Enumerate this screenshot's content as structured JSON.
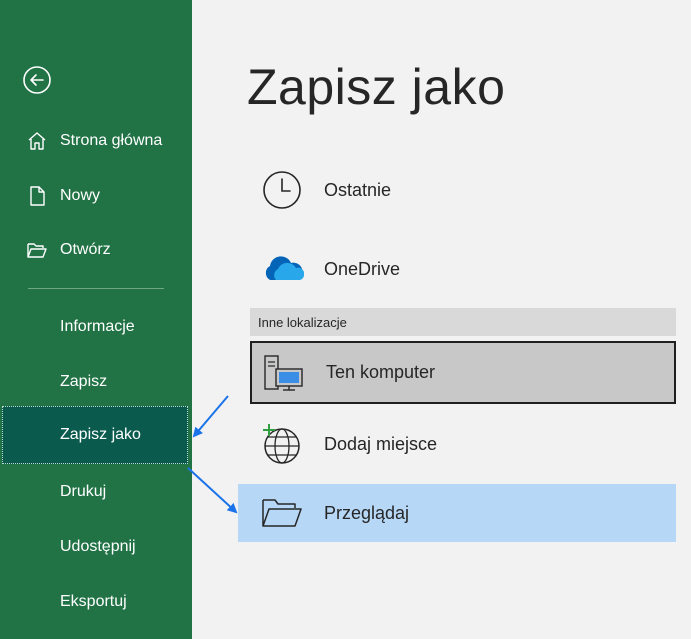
{
  "sidebar": {
    "back_icon": "arrow-left-circle-icon",
    "items": [
      {
        "label": "Strona główna",
        "icon": "home-icon"
      },
      {
        "label": "Nowy",
        "icon": "new-document-icon"
      },
      {
        "label": "Otwórz",
        "icon": "open-folder-icon"
      },
      {
        "label": "Informacje"
      },
      {
        "label": "Zapisz"
      },
      {
        "label": "Zapisz jako",
        "selected": true
      },
      {
        "label": "Drukuj"
      },
      {
        "label": "Udostępnij"
      },
      {
        "label": "Eksportuj"
      }
    ]
  },
  "main": {
    "title": "Zapisz jako",
    "locations": [
      {
        "label": "Ostatnie",
        "icon": "clock-icon"
      },
      {
        "label": "OneDrive",
        "icon": "cloud-icon"
      }
    ],
    "other_locations_header": "Inne lokalizacje",
    "other_locations": [
      {
        "label": "Ten komputer",
        "icon": "computer-icon",
        "highlighted": true
      },
      {
        "label": "Dodaj miejsce",
        "icon": "add-place-globe-icon"
      },
      {
        "label": "Przeglądaj",
        "icon": "folder-browse-icon",
        "selected": true
      }
    ]
  },
  "colors": {
    "sidebar_bg": "#217346",
    "sidebar_selected": "#0a5a4e",
    "browse_highlight": "#b7d7f7",
    "arrow": "#1a73e8"
  }
}
